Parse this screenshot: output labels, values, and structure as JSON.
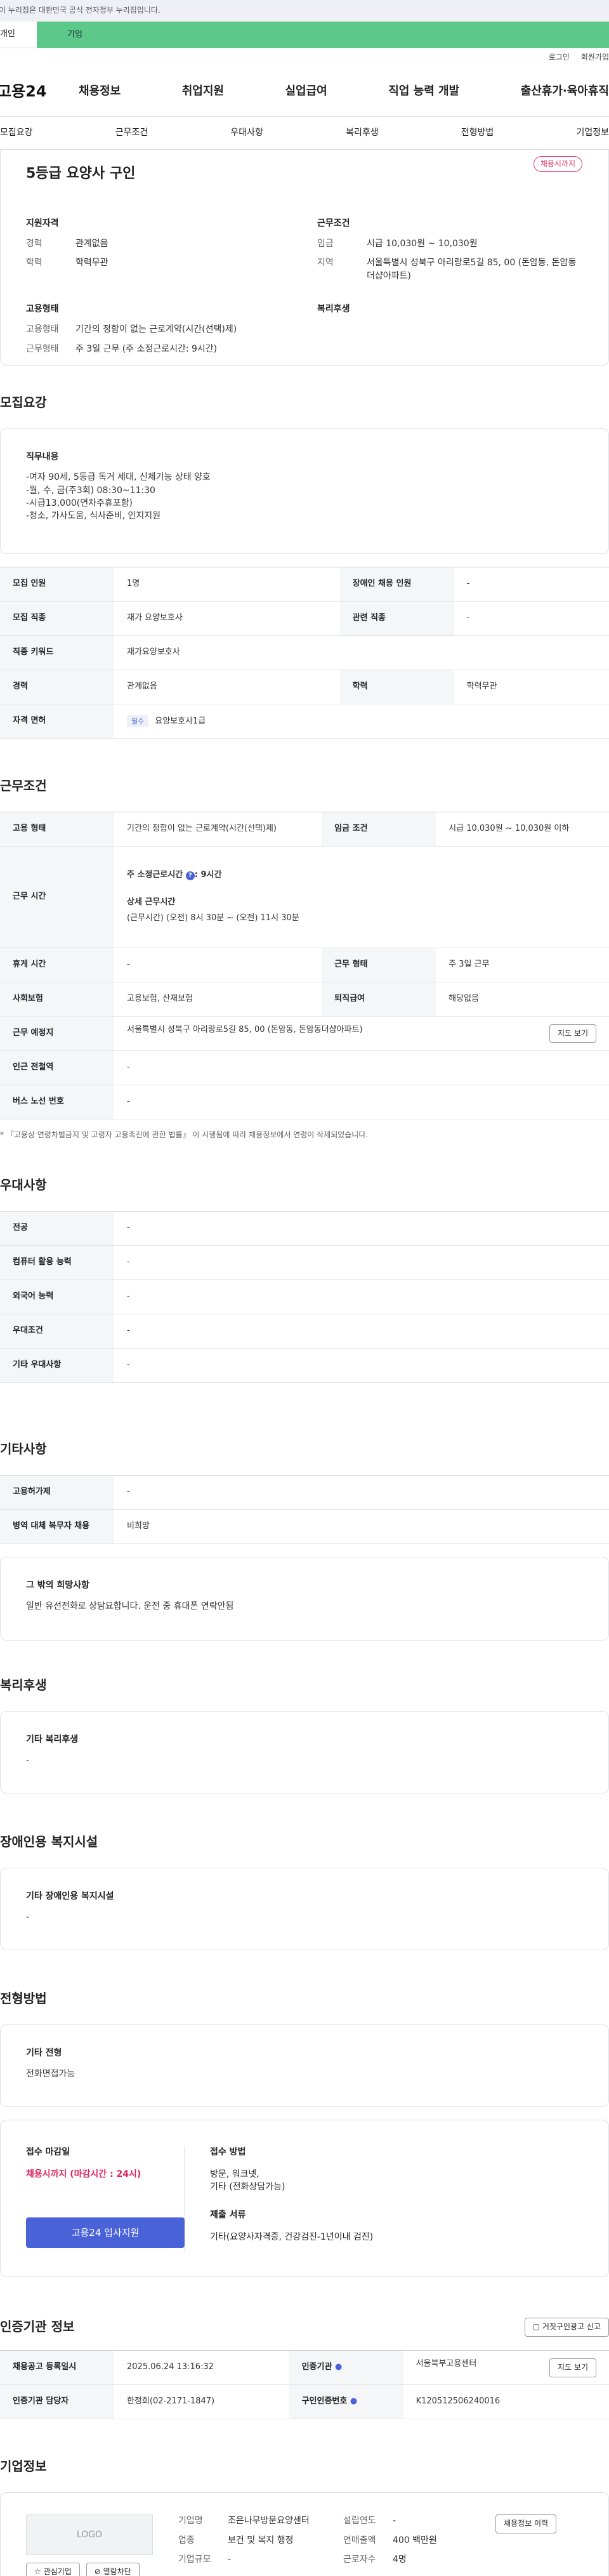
{
  "gov_banner": "이 누리집은 대한민국 공식 전자정부 누리집입니다.",
  "top_tabs": [
    "개인",
    "기업"
  ],
  "util": [
    "로그인",
    "회원가입"
  ],
  "logo": "고용24",
  "gnb": [
    "채용정보",
    "취업지원",
    "실업급여",
    "직업 능력 개발",
    "출산휴가·육아휴직"
  ],
  "anchor": [
    "모집요강",
    "근무조건",
    "우대사항",
    "복리후생",
    "전형방법",
    "기업정보"
  ],
  "job": {
    "title": "5등급 요양사 구인",
    "badge": "채용시까지",
    "qual_title": "지원자격",
    "qual": [
      [
        "경력",
        "관계없음"
      ],
      [
        "학력",
        "학력무관"
      ]
    ],
    "cond_title": "근무조건",
    "cond": [
      [
        "임금",
        "시급 10,030원 ~ 10,030원"
      ],
      [
        "지역",
        "서울특별시 성북구 아리랑로5길 85, 00 (돈암동, 돈암동더샵아파트)"
      ]
    ],
    "emp_title": "고용형태",
    "emp": [
      [
        "고용형태",
        "기간의 정함이 없는 근로계약(시간(선택)제)"
      ],
      [
        "근무형태",
        "주 3일 근무 (주 소정근로시간: 9시간)"
      ]
    ],
    "welfare_title": "복리후생"
  },
  "recruit": {
    "title": "모집요강",
    "duty_title": "직무내용",
    "duty": "-여자 90세, 5등급 독거 세대, 신체기능 상태 양호\n-월, 수, 금(주3회)  08:30~11:30\n-시급13,000(연차주휴포함)\n-청소, 가사도움, 식사준비, 인지지원",
    "rows": [
      [
        "모집 인원",
        "1명",
        "장애인 채용 인원",
        "-"
      ],
      [
        "모집 직종",
        "재가 요양보호사",
        "관련 직종",
        "-"
      ],
      [
        "직종 키워드",
        "재가요양보호사",
        "",
        ""
      ],
      [
        "경력",
        "관계없음",
        "학력",
        "학력무관"
      ]
    ],
    "license_label": "자격 면허",
    "license_tag": "필수",
    "license": "요양보호사1급"
  },
  "work": {
    "title": "근무조건",
    "type_l": "고용 형태",
    "type_v": "기간의 정함이 없는 근로계약(시간(선택)제)",
    "wage_l": "임금 조건",
    "wage_v": "시급 10,030원 ~ 10,030원 이하",
    "hours_l": "근무 시간",
    "hours_1": "주 소정근로시간",
    "hours_2": ": 9시간",
    "hours_3": "상세 근무시간",
    "hours_4": "(근무시간) (오전) 8시 30분 ~ (오전) 11시 30분",
    "rows": [
      [
        "휴게 시간",
        "-",
        "근무 형태",
        "주 3일 근무"
      ],
      [
        "사회보험",
        "고용보험, 산재보험",
        "퇴직급여",
        "해당없음"
      ]
    ],
    "place_l": "근무 예정지",
    "place_v": "서울특별시 성북구 아리랑로5길 85, 00 (돈암동, 돈암동더샵아파트)",
    "map": "지도 보기",
    "station_l": "인근 전철역",
    "station_v": "-",
    "bus_l": "버스 노선 번호",
    "bus_v": "-",
    "note": "* 『고용상 연령차별금지 및 고령자 고용촉진에 관한 법률』 이 시행됨에 따라 채용정보에서 연령이 삭제되었습니다."
  },
  "pref": {
    "title": "우대사항",
    "rows": [
      [
        "전공",
        "-"
      ],
      [
        "컴퓨터 활용 능력",
        "-"
      ],
      [
        "외국어 능력",
        "-"
      ],
      [
        "우대조건",
        "-"
      ],
      [
        "기타 우대사항",
        "-"
      ]
    ]
  },
  "etc": {
    "title": "기타사항",
    "rows": [
      [
        "고용허가제",
        "-"
      ],
      [
        "병역 대체 복무자 채용",
        "비희망"
      ]
    ],
    "hope_t": "그 밖의 희망사항",
    "hope": "일반 유선전화로 상담요합니다. 운전 중 휴대폰 연락안됨"
  },
  "welfare": {
    "title": "복리후생",
    "sub": "기타 복리후생",
    "val": "-"
  },
  "disabled": {
    "title": "장애인용 복지시설",
    "sub": "기타 장애인용 복지시설",
    "val": "-"
  },
  "select": {
    "title": "전형방법",
    "sub": "기타 전형",
    "val": "전화면접가능",
    "deadline_t": "접수 마감일",
    "deadline": "채용시까지 (마감시간 : 24시)",
    "method_t": "접수 방법",
    "method": "방문, 워크넷,\n기타 (전화상담가능)",
    "docs_t": "제출 서류",
    "docs": "기타(요양사자격증, 건강검진-1년이내 검진)",
    "apply_btn": "고용24 입사지원"
  },
  "cert": {
    "title": "인증기관 정보",
    "report": "거짓구인광고 신고",
    "rows": [
      [
        "채용공고 등록일시",
        "2025.06.24 13:16:32",
        "인증기관",
        "서울북부고용센터"
      ],
      [
        "인증기관 담당자",
        "한정희(02-2171-1847)",
        "구인인증번호",
        "K120512506240016"
      ]
    ],
    "map": "지도 보기"
  },
  "company": {
    "title": "기업정보",
    "logo": "LOGO",
    "fav": "관심기업",
    "block": "열람차단",
    "name_l": "기업명",
    "name": "조은나무방문요양센터",
    "ind_l": "업종",
    "ind": "보건 및 복지 행정",
    "size_l": "기업규모",
    "size": "-",
    "year_l": "설립연도",
    "year": "-",
    "sales_l": "연매출액",
    "sales": "400 백만원",
    "emp_l": "근로자수",
    "emp": "4명",
    "history": "채용정보 이력"
  }
}
